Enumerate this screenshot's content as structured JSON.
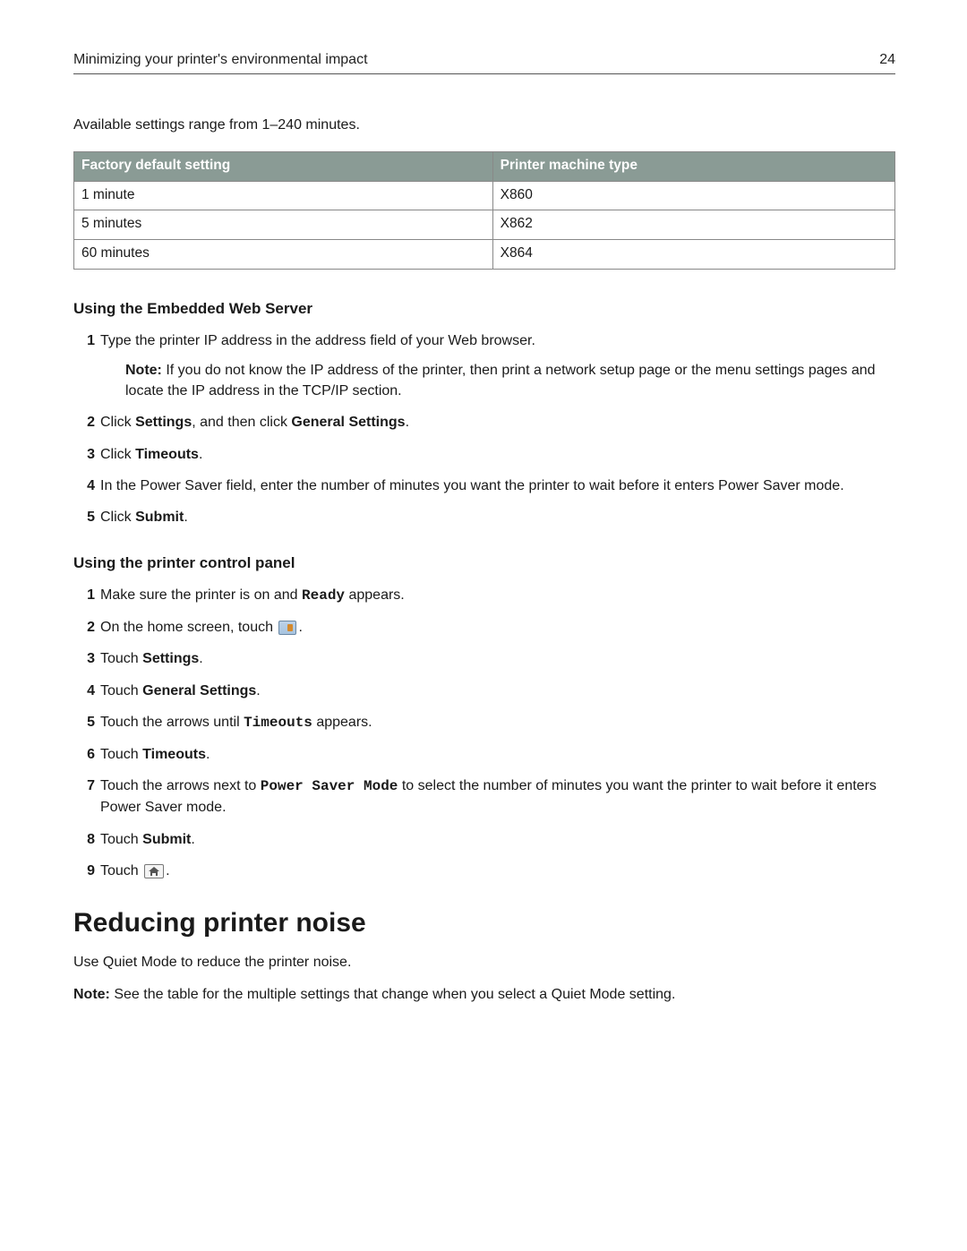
{
  "header": {
    "title": "Minimizing your printer's environmental impact",
    "page_number": "24"
  },
  "intro": "Available settings range from 1–240 minutes.",
  "table": {
    "headers": [
      "Factory default setting",
      "Printer machine type"
    ],
    "rows": [
      {
        "setting": "1 minute",
        "type": "X860"
      },
      {
        "setting": "5 minutes",
        "type": "X862"
      },
      {
        "setting": "60 minutes",
        "type": "X864"
      }
    ]
  },
  "section_web": {
    "heading": "Using the Embedded Web Server",
    "step1_text": "Type the printer IP address in the address field of your Web browser.",
    "step1_note_label": "Note:",
    "step1_note_body": " If you do not know the IP address of the printer, then print a network setup page or the menu settings pages and locate the IP address in the TCP/IP section.",
    "step2_a": "Click ",
    "step2_b": "Settings",
    "step2_c": ", and then click ",
    "step2_d": "General Settings",
    "step2_e": ".",
    "step3_a": "Click ",
    "step3_b": "Timeouts",
    "step3_c": ".",
    "step4": "In the Power Saver field, enter the number of minutes you want the printer to wait before it enters Power Saver mode.",
    "step5_a": "Click ",
    "step5_b": "Submit",
    "step5_c": "."
  },
  "section_panel": {
    "heading": "Using the printer control panel",
    "step1_a": "Make sure the printer is on and ",
    "step1_b": "Ready",
    "step1_c": " appears.",
    "step2_a": "On the home screen, touch ",
    "step2_c": ".",
    "step3_a": "Touch ",
    "step3_b": "Settings",
    "step3_c": ".",
    "step4_a": "Touch ",
    "step4_b": "General Settings",
    "step4_c": ".",
    "step5_a": "Touch the arrows until ",
    "step5_b": "Timeouts",
    "step5_c": " appears.",
    "step6_a": "Touch ",
    "step6_b": "Timeouts",
    "step6_c": ".",
    "step7_a": "Touch the arrows next to ",
    "step7_b": "Power Saver Mode",
    "step7_c": " to select the number of minutes you want the printer to wait before it enters Power Saver mode.",
    "step8_a": "Touch ",
    "step8_b": "Submit",
    "step8_c": ".",
    "step9_a": "Touch ",
    "step9_c": "."
  },
  "section_noise": {
    "title": "Reducing printer noise",
    "line1": "Use Quiet Mode to reduce the printer noise.",
    "line2_label": "Note:",
    "line2_body": " See the table for the multiple settings that change when you select a Quiet Mode setting."
  },
  "nums": {
    "n1": "1",
    "n2": "2",
    "n3": "3",
    "n4": "4",
    "n5": "5",
    "n6": "6",
    "n7": "7",
    "n8": "8",
    "n9": "9"
  }
}
